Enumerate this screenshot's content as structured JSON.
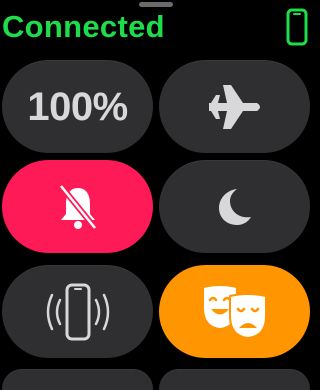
{
  "status": {
    "title": "Connected",
    "connection_color": "#1edc4a",
    "phone_icon": "iphone-icon"
  },
  "tiles": [
    {
      "id": "battery",
      "label": "100%",
      "icon": null,
      "active": false
    },
    {
      "id": "airplane-mode",
      "label": "",
      "icon": "airplane-icon",
      "active": false
    },
    {
      "id": "silent-mode",
      "label": "",
      "icon": "bell-slash-icon",
      "active": true,
      "color": "#fe1a56"
    },
    {
      "id": "do-not-disturb",
      "label": "",
      "icon": "moon-icon",
      "active": false
    },
    {
      "id": "ping-iphone",
      "label": "",
      "icon": "phone-ping-icon",
      "active": false
    },
    {
      "id": "theater-mode",
      "label": "",
      "icon": "theater-masks-icon",
      "active": true,
      "color": "#ff9500"
    }
  ],
  "colors": {
    "tile_inactive": "#2f2f31",
    "icon_inactive": "#d8d8da",
    "icon_active": "#ffffff"
  }
}
